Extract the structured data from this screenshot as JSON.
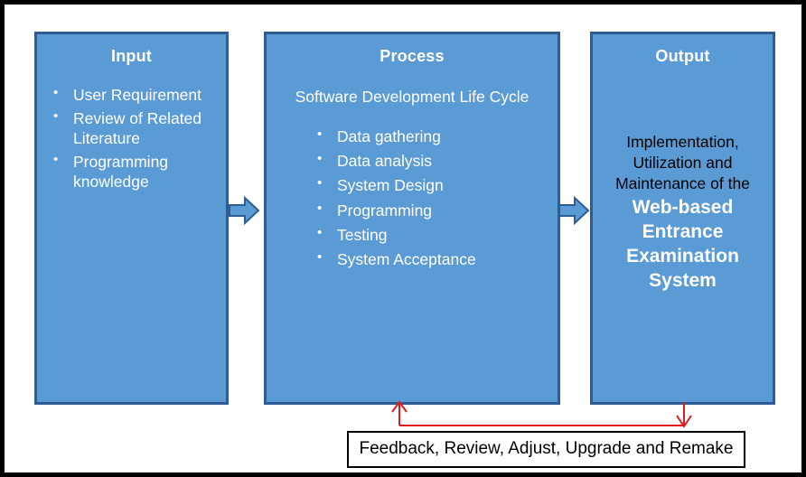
{
  "diagram": {
    "type": "input-process-output",
    "accent_box_fill": "#5B9BD5",
    "accent_box_border": "#2E5C94",
    "feedback_line_color": "#E01B1B",
    "frame_color": "#000000",
    "boxes": [
      {
        "id": "input",
        "title": "Input",
        "items": [
          "User Requirement",
          "Review of Related Literature",
          "Programming knowledge"
        ]
      },
      {
        "id": "process",
        "title": "Process",
        "subtitle": "Software Development Life Cycle",
        "items": [
          "Data gathering",
          "Data analysis",
          "System Design",
          "Programming",
          "Testing",
          "System Acceptance"
        ]
      },
      {
        "id": "output",
        "title": "Output",
        "lead": "Implementation, Utilization and Maintenance of the",
        "emphasis": "Web-based Entrance Examination System"
      }
    ],
    "connectors": [
      {
        "id": "input-to-process",
        "icon": "right-block-arrow"
      },
      {
        "id": "process-to-output",
        "icon": "right-block-arrow"
      }
    ],
    "feedback": {
      "label": "Feedback, Review, Adjust, Upgrade and Remake",
      "from": "Output",
      "to": "Process"
    }
  }
}
